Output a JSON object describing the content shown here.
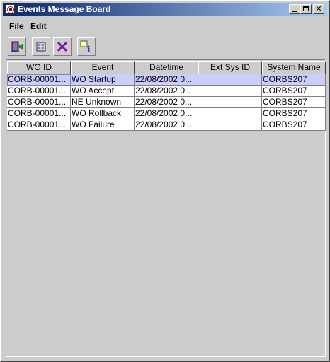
{
  "window": {
    "title": "Events Message Board"
  },
  "menu": {
    "file": {
      "mnemonic": "F",
      "rest": "ile"
    },
    "edit": {
      "mnemonic": "E",
      "rest": "dit"
    }
  },
  "table": {
    "columns": [
      "WO ID",
      "Event",
      "Datetime",
      "Ext Sys ID",
      "System Name"
    ],
    "rows": [
      [
        "CORB-00001...",
        "WO Startup",
        "22/08/2002 0...",
        "",
        "CORBS207"
      ],
      [
        "CORB-00001...",
        "WO Accept",
        "22/08/2002 0...",
        "",
        "CORBS207"
      ],
      [
        "CORB-00001...",
        "NE Unknown",
        "22/08/2002 0...",
        "",
        "CORBS207"
      ],
      [
        "CORB-00001...",
        "WO Rollback",
        "22/08/2002 0...",
        "",
        "CORBS207"
      ],
      [
        "CORB-00001...",
        "WO Failure",
        "22/08/2002 0...",
        "",
        "CORBS207"
      ]
    ],
    "selected_row": 0
  },
  "toolbar": {
    "icons": [
      "exit-door-icon",
      "refresh-icon",
      "delete-icon",
      "info-icon"
    ]
  }
}
